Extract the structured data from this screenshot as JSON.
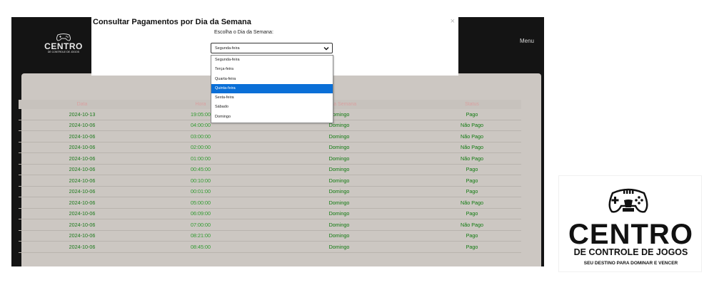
{
  "app": {
    "logo": {
      "title": "CENTRO",
      "subtitle": "DE CONTROLE DE JOGOS"
    },
    "menu_label": "Menu",
    "panel_title_fragment": "os",
    "table": {
      "headers": [
        "Data",
        "Hora",
        "Dia da Semana",
        "Status"
      ],
      "rows": [
        {
          "date": "2024-10-13",
          "time": "19:05:00",
          "day": "Domingo",
          "status": "Pago"
        },
        {
          "date": "2024-10-06",
          "time": "04:00:00",
          "day": "Domingo",
          "status": "Não Pago"
        },
        {
          "date": "2024-10-06",
          "time": "03:00:00",
          "day": "Domingo",
          "status": "Não Pago"
        },
        {
          "date": "2024-10-06",
          "time": "02:00:00",
          "day": "Domingo",
          "status": "Não Pago"
        },
        {
          "date": "2024-10-06",
          "time": "01:00:00",
          "day": "Domingo",
          "status": "Não Pago"
        },
        {
          "date": "2024-10-06",
          "time": "00:45:00",
          "day": "Domingo",
          "status": "Pago"
        },
        {
          "date": "2024-10-06",
          "time": "00:10:00",
          "day": "Domingo",
          "status": "Pago"
        },
        {
          "date": "2024-10-06",
          "time": "00:01:00",
          "day": "Domingo",
          "status": "Pago"
        },
        {
          "date": "2024-10-06",
          "time": "05:00:00",
          "day": "Domingo",
          "status": "Não Pago"
        },
        {
          "date": "2024-10-06",
          "time": "06:09:00",
          "day": "Domingo",
          "status": "Pago"
        },
        {
          "date": "2024-10-06",
          "time": "07:00:00",
          "day": "Domingo",
          "status": "Não Pago"
        },
        {
          "date": "2024-10-06",
          "time": "08:21:00",
          "day": "Domingo",
          "status": "Pago"
        },
        {
          "date": "2024-10-06",
          "time": "08:45:00",
          "day": "Domingo",
          "status": "Pago"
        }
      ]
    }
  },
  "modal": {
    "title": "Consultar Pagamentos por Dia da Semana",
    "close_symbol": "×",
    "label": "Escolha o Dia da Semana:",
    "selected_value": "Segunda-feira",
    "options": [
      "Segunda-feira",
      "Terça-feira",
      "Quarta-feira",
      "Quinta-feira",
      "Sexta-feira",
      "Sábado",
      "Domingo"
    ],
    "highlighted_option": "Quinta-feira"
  },
  "brand": {
    "main": "CENTRO",
    "sub": "DE CONTROLE DE JOGOS",
    "tagline": "SEU DESTINO PARA DOMINAR E VENCER"
  },
  "colors": {
    "header_bg": "#141414",
    "panel_bg": "#ccc7c2",
    "accent_green": "#0d9c12",
    "highlight_blue": "#0a6fd7"
  },
  "icons": [
    "gamepad-icon",
    "close-icon",
    "chevron-down-icon"
  ]
}
